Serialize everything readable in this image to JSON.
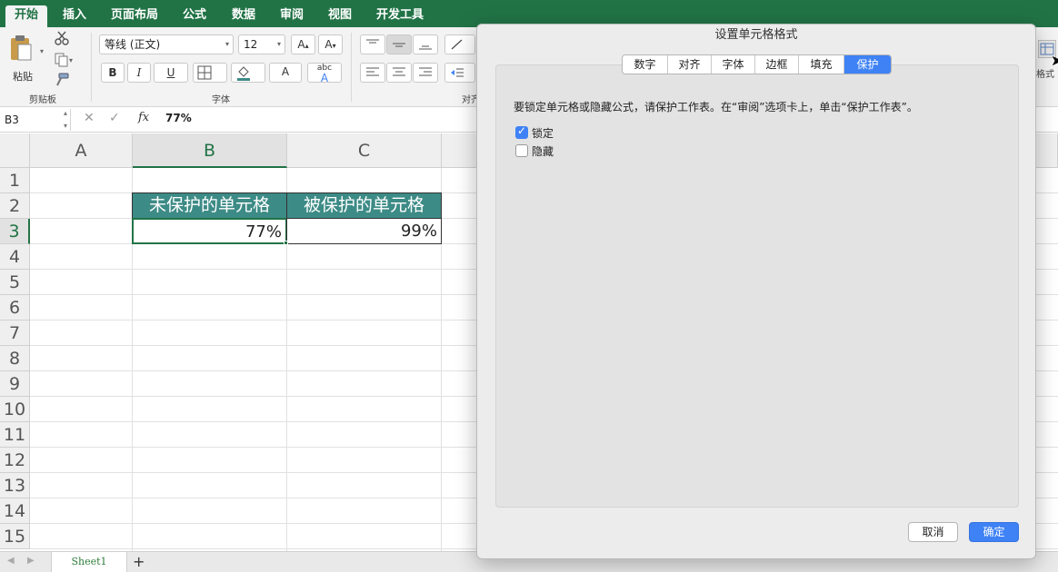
{
  "ribbon": {
    "tabs": [
      "开始",
      "插入",
      "页面布局",
      "公式",
      "数据",
      "审阅",
      "视图",
      "开发工具"
    ],
    "active_tab": "开始",
    "groups": {
      "clipboard": "剪贴板",
      "font": "字体",
      "align_partial": "对齐",
      "format_partial": "格式"
    },
    "paste_label": "粘贴",
    "font_name": "等线 (正文)",
    "font_size": "12",
    "bold": "B",
    "italic": "I",
    "underline": "U",
    "font_color_glyph": "A",
    "grow_font": "A",
    "shrink_font": "A",
    "phonetic": "abc"
  },
  "formula_bar": {
    "name_box": "B3",
    "fx": "fx",
    "value": "77%"
  },
  "grid": {
    "columns": [
      "A",
      "B",
      "C"
    ],
    "rows": [
      "1",
      "2",
      "3",
      "4",
      "5",
      "6",
      "7",
      "8",
      "9",
      "10",
      "11",
      "12",
      "13",
      "14",
      "15"
    ],
    "selected_column": "B",
    "selected_row": "3",
    "header_cells": [
      "未保护的单元格",
      "被保护的单元格"
    ],
    "value_cells": [
      "77%",
      "99%"
    ]
  },
  "sheets": {
    "tabs": [
      "Sheet1"
    ],
    "add": "+"
  },
  "dialog": {
    "title": "设置单元格格式",
    "tabs": [
      "数字",
      "对齐",
      "字体",
      "边框",
      "填充",
      "保护"
    ],
    "active_tab": "保护",
    "description": "要锁定单元格或隐藏公式，请保护工作表。在“审阅”选项卡上，单击“保护工作表”。",
    "checkboxes": [
      {
        "label": "锁定",
        "checked": true
      },
      {
        "label": "隐藏",
        "checked": false
      }
    ],
    "cancel": "取消",
    "ok": "确定"
  },
  "colors": {
    "excel_green": "#217346",
    "header_fill": "#3d8b86",
    "accent_blue": "#3f82f5"
  }
}
